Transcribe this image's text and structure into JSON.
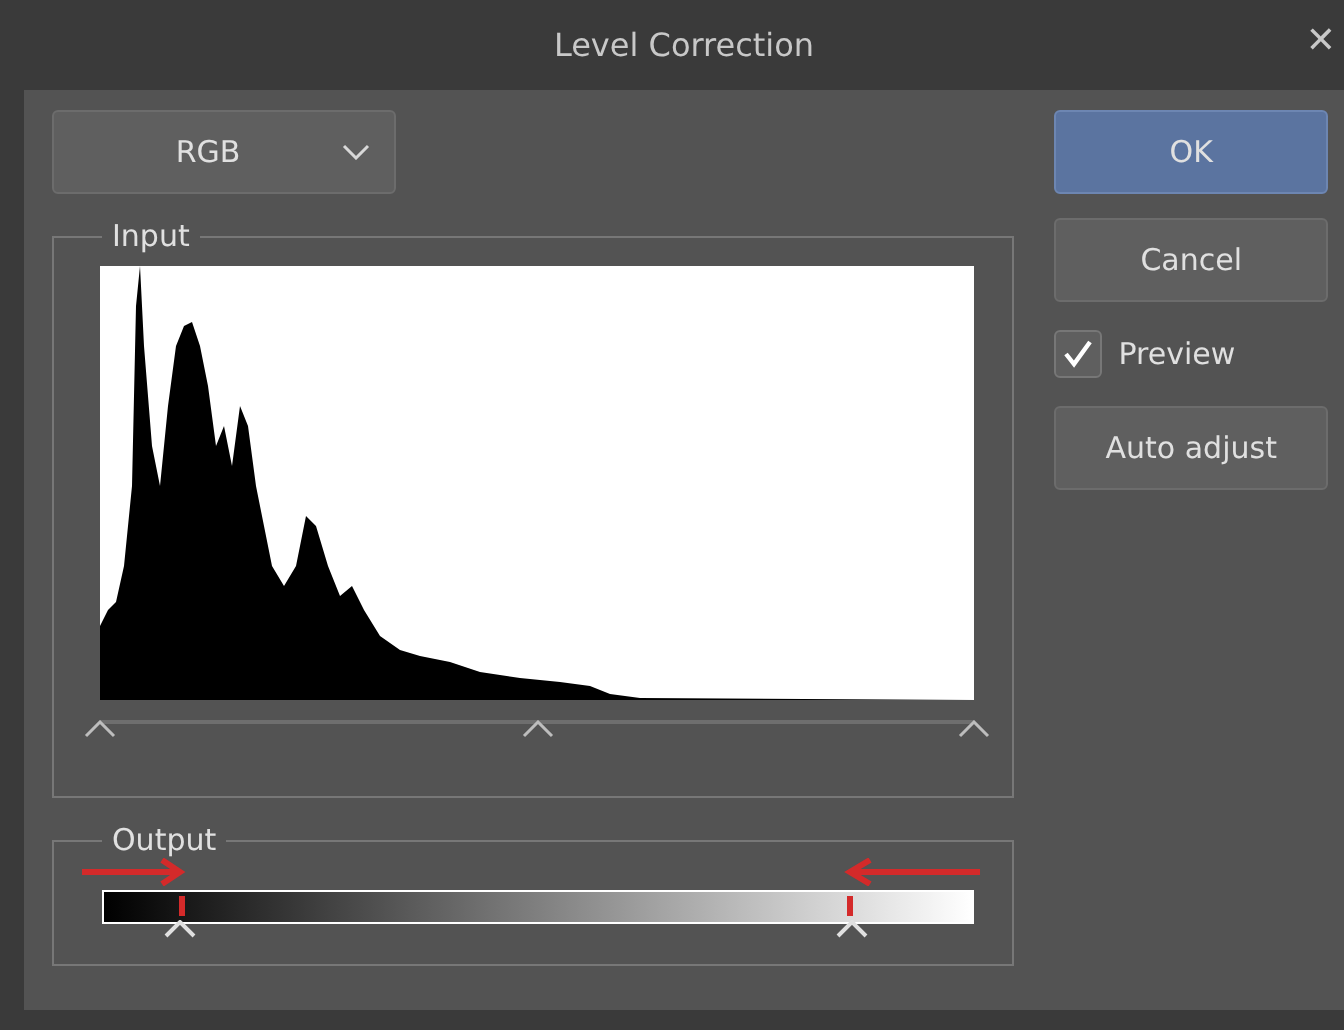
{
  "window": {
    "title": "Level Correction",
    "close": "✕"
  },
  "channel": {
    "value": "RGB"
  },
  "input": {
    "label": "Input",
    "handles": [
      {
        "level": 0
      },
      {
        "level": 0.5
      },
      {
        "level": 1
      }
    ]
  },
  "output": {
    "label": "Output",
    "handles": [
      {
        "level": 0.09
      },
      {
        "level": 0.86
      }
    ]
  },
  "buttons": [
    {
      "label": "OK",
      "kind": "primary"
    },
    {
      "label": "Cancel",
      "kind": "normal"
    }
  ],
  "preview": {
    "label": "Preview",
    "checked": true
  },
  "auto_button": {
    "label": "Auto adjust"
  }
}
